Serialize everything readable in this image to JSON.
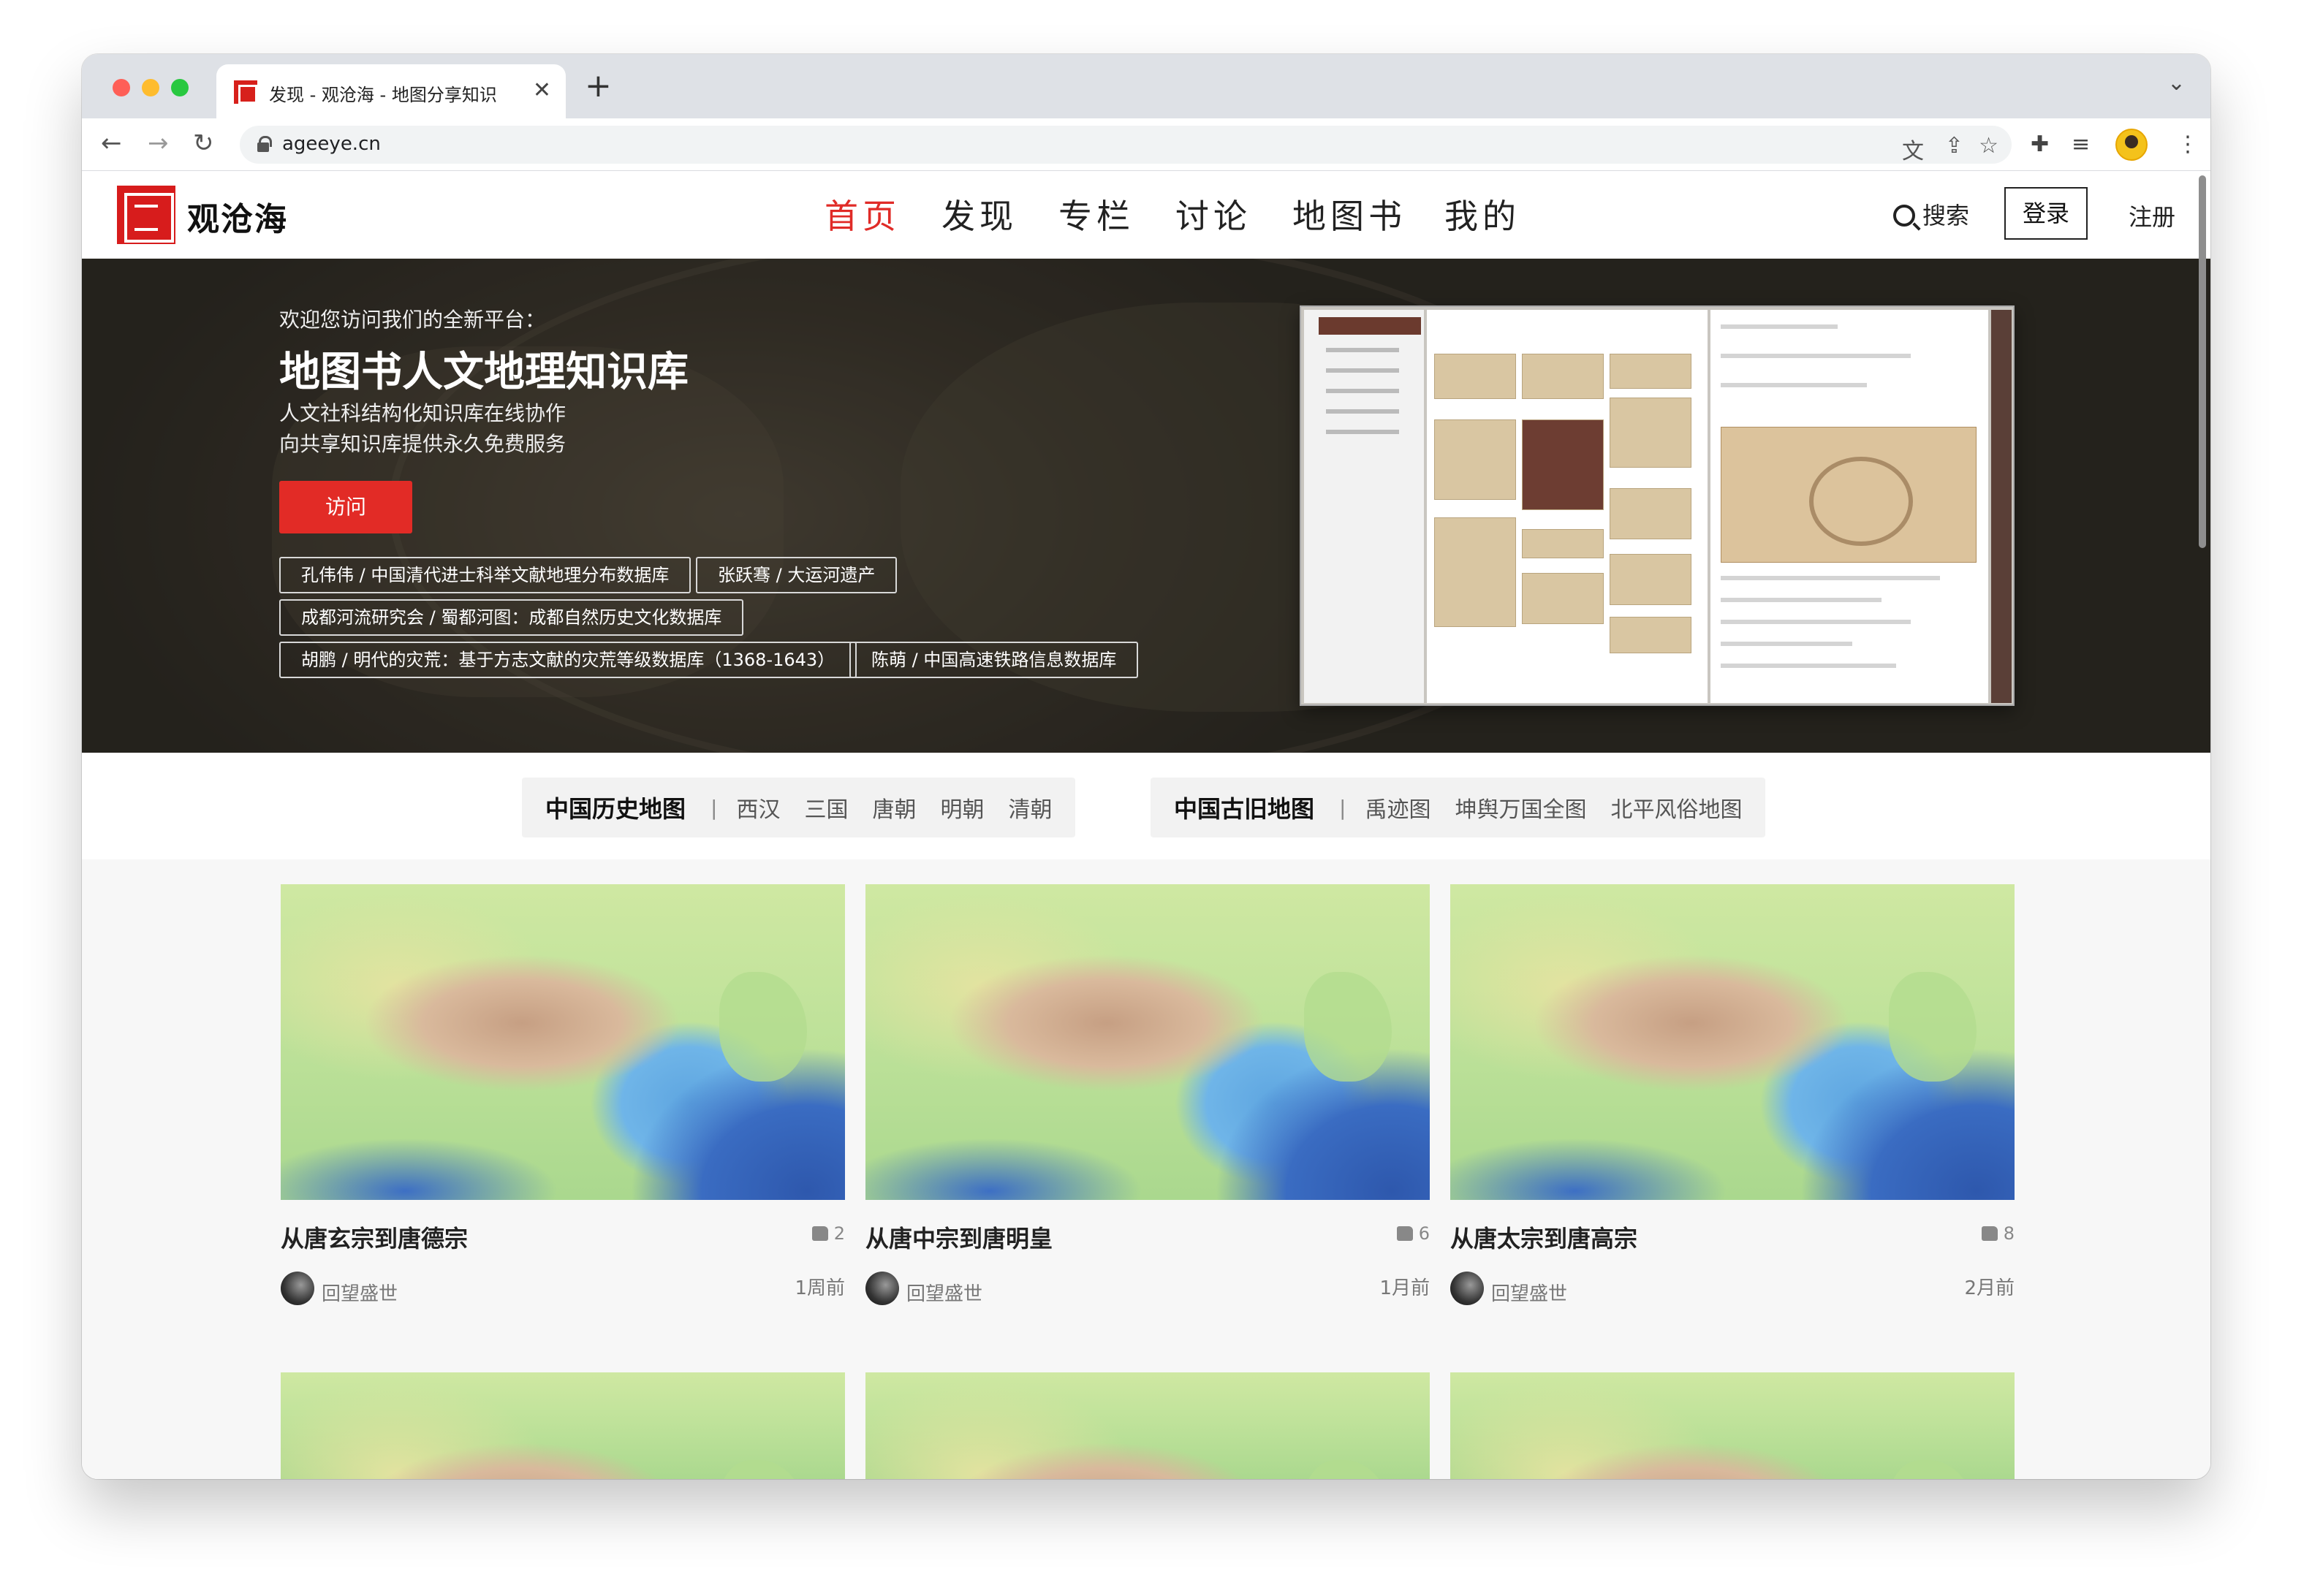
{
  "browser": {
    "tab_title": "发现 - 观沧海 - 地图分享知识",
    "url": "ageeye.cn",
    "icons": [
      "back-icon",
      "forward-icon",
      "reload-icon",
      "lock-icon",
      "translate-icon",
      "share-icon",
      "star-icon",
      "extensions-icon",
      "reading-list-icon",
      "side-panel-icon",
      "profile-avatar",
      "menu-icon"
    ]
  },
  "site": {
    "logo_text": "观沧海",
    "brand_color": "#e02b27",
    "nav": [
      {
        "label": "首页",
        "active": true
      },
      {
        "label": "发现",
        "active": false
      },
      {
        "label": "专栏",
        "active": false
      },
      {
        "label": "讨论",
        "active": false
      },
      {
        "label": "地图书",
        "active": false
      },
      {
        "label": "我的",
        "active": false
      }
    ],
    "search_label": "搜索",
    "login_label": "登录",
    "register_label": "注册"
  },
  "hero": {
    "pretitle": "欢迎您访问我们的全新平台：",
    "title": "地图书人文地理知识库",
    "subtitle_1": "人文社科结构化知识库在线协作",
    "subtitle_2": "向共享知识库提供永久免费服务",
    "visit_label": "访问",
    "chips": [
      "孔伟伟 / 中国清代进士科举文献地理分布数据库",
      "张跃骞 / 大运河遗产",
      "成都河流研究会 / 蜀都河图：成都自然历史文化数据库",
      "胡鹏 / 明代的灾荒：基于方志文献的灾荒等级数据库（1368-1643）",
      "陈萌 / 中国高速铁路信息数据库"
    ]
  },
  "categories": {
    "group_1": {
      "title": "中国历史地图",
      "links": [
        "西汉",
        "三国",
        "唐朝",
        "明朝",
        "清朝"
      ]
    },
    "group_2": {
      "title": "中国古旧地图",
      "links": [
        "禹迹图",
        "坤舆万国全图",
        "北平风俗地图"
      ]
    }
  },
  "cards": [
    {
      "title": "从唐玄宗到唐德宗",
      "likes": "2",
      "author": "回望盛世",
      "time": "1周前"
    },
    {
      "title": "从唐中宗到唐明皇",
      "likes": "6",
      "author": "回望盛世",
      "time": "1月前"
    },
    {
      "title": "从唐太宗到唐高宗",
      "likes": "8",
      "author": "回望盛世",
      "time": "2月前"
    }
  ]
}
